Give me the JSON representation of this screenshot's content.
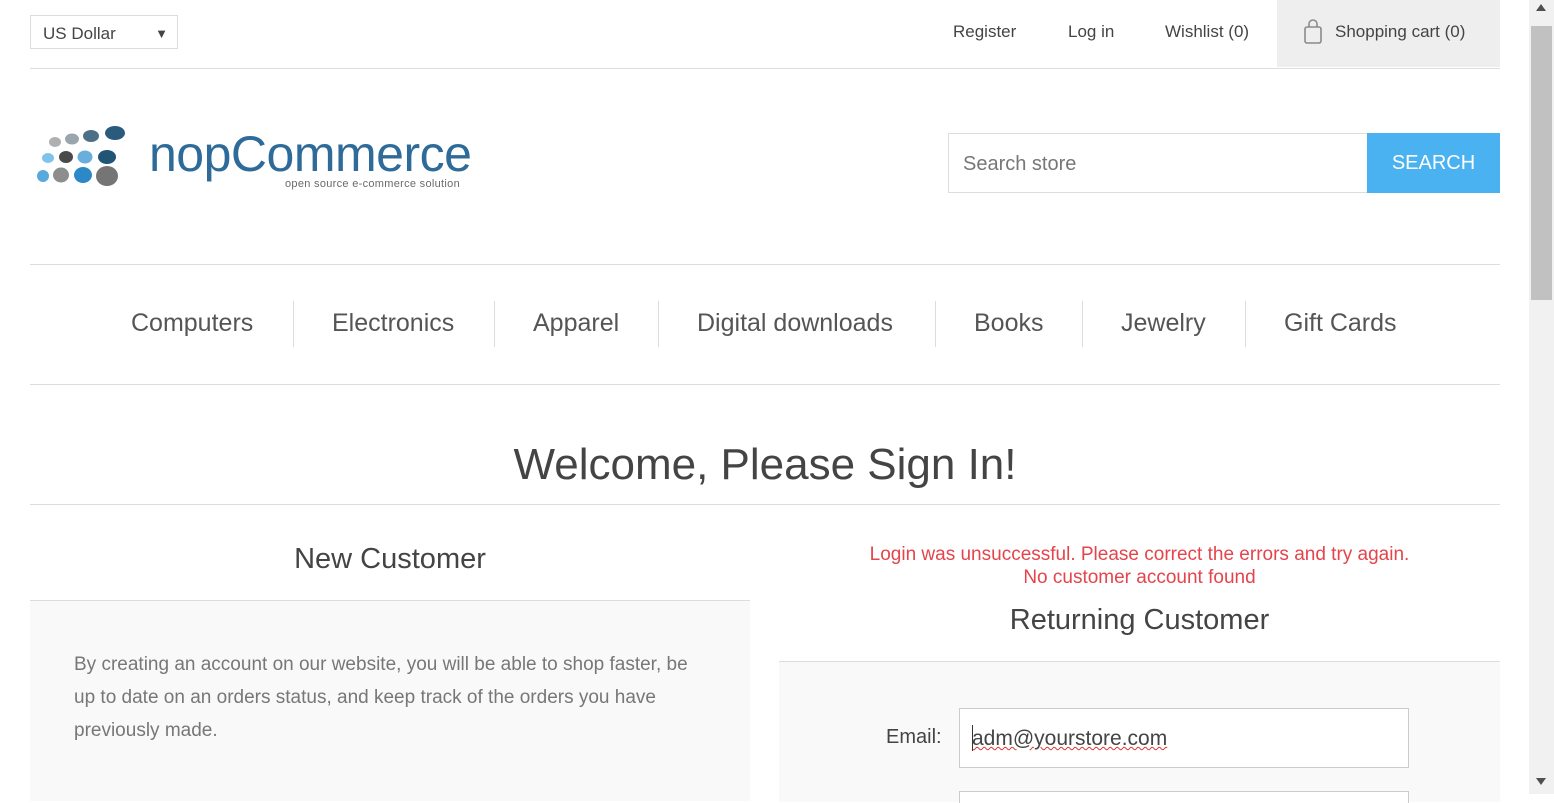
{
  "header": {
    "currency": "US Dollar",
    "links": {
      "register": "Register",
      "login": "Log in",
      "wishlist": "Wishlist (0)",
      "cart": "Shopping cart (0)"
    }
  },
  "logo": {
    "name": "nopCommerce",
    "tagline": "open source e-commerce solution"
  },
  "search": {
    "placeholder": "Search store",
    "button": "SEARCH"
  },
  "menu": [
    "Computers",
    "Electronics",
    "Apparel",
    "Digital downloads",
    "Books",
    "Jewelry",
    "Gift Cards"
  ],
  "page": {
    "title": "Welcome, Please Sign In!"
  },
  "new_customer": {
    "title": "New Customer",
    "text": "By creating an account on our website, you will be able to shop faster, be up to date on an orders status, and keep track of the orders you have previously made."
  },
  "returning_customer": {
    "error_line1": "Login was unsuccessful. Please correct the errors and try again.",
    "error_line2": "No customer account found",
    "title": "Returning Customer",
    "email_label": "Email:",
    "email_value": "adm@yourstore.com"
  },
  "colors": {
    "accent": "#4ab2f1",
    "error": "#e4444c",
    "logo_text": "#2f6b99"
  },
  "icons": {
    "cart": "shopping-bag-icon",
    "currency_caret": "caret-down-icon"
  }
}
